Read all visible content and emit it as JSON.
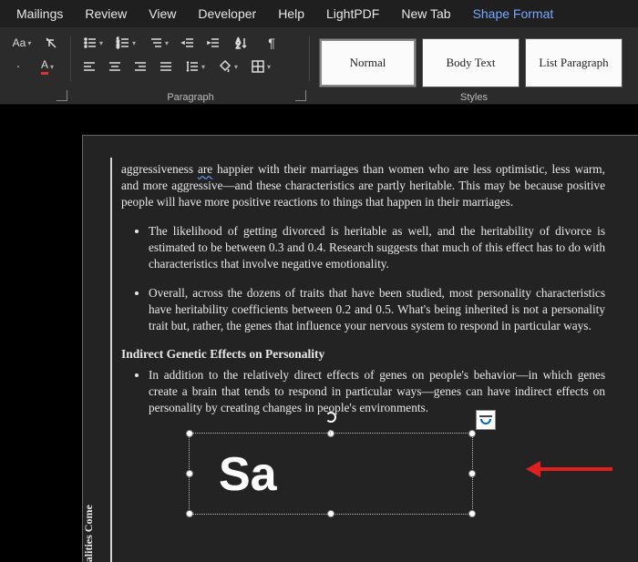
{
  "menu": {
    "items": [
      "Mailings",
      "Review",
      "View",
      "Developer",
      "Help",
      "LightPDF",
      "New Tab",
      "Shape Format"
    ],
    "active_index": 7
  },
  "ribbon": {
    "font": {
      "label": "",
      "size_sample": "Aa",
      "color_char": "A"
    },
    "paragraph": {
      "label": "Paragraph"
    },
    "styles": {
      "label": "Styles",
      "tiles": [
        "Normal",
        "Body Text",
        "List Paragraph"
      ],
      "selected_index": 0
    }
  },
  "doc": {
    "para1_pre": "aggressiveness ",
    "para1_wavy": "are",
    "para1_post": " happier with their marriages than women who are less optimistic, less warm, and more aggressive—and these characteristics are partly heritable. This may be because positive people will have more positive reactions to things that happen in their marriages.",
    "bullet1": "The likelihood of getting divorced is heritable as well, and the heritability of divorce is estimated to be between 0.3 and 0.4. Research suggests that much of this effect has to do with characteristics that involve negative emotionality.",
    "bullet2": "Overall, across the dozens of traits that have been studied, most personality characteristics have heritability coefficients between 0.2 and 0.5. What's being inherited is not a personality trait but, rather, the genes that influence your nervous system to respond in particular ways.",
    "heading": "Indirect Genetic Effects on Personality",
    "bullet3": "In addition to the relatively direct effects of genes on people's behavior—in which genes create a brain that tends to respond in particular ways—genes can have indirect effects on personality by creating changes in people's environments.",
    "sidecap": "alities Come",
    "wordart": "Sa"
  }
}
